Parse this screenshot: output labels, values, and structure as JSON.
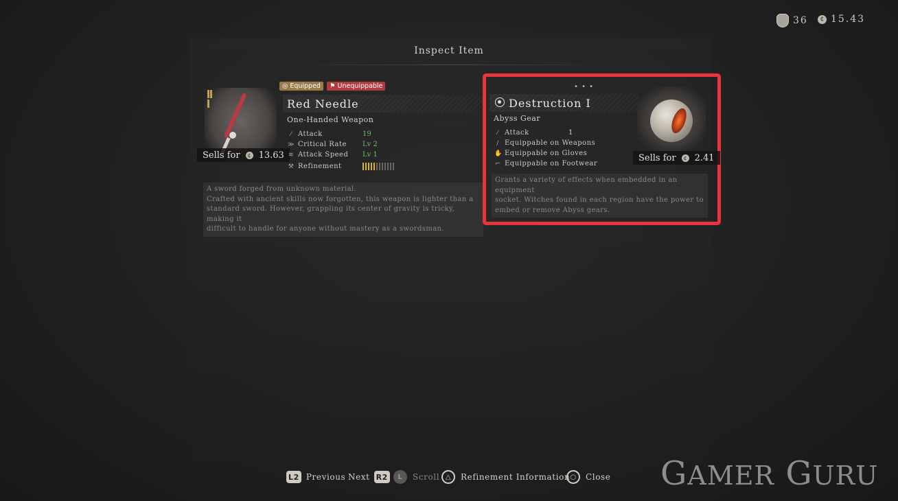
{
  "hud": {
    "tokens": "36",
    "currency": "15.43"
  },
  "title": "Inspect Item",
  "left_item": {
    "badges": {
      "equipped": "Equipped",
      "unequippable": "Unequippable"
    },
    "name": "Red Needle",
    "type": "One-Handed Weapon",
    "stats": [
      {
        "icon": "sword-icon",
        "label": "Attack",
        "value": "19"
      },
      {
        "icon": "critical-icon",
        "label": "Critical Rate",
        "value": "Lv 2"
      },
      {
        "icon": "speed-icon",
        "label": "Attack Speed",
        "value": "Lv 1"
      },
      {
        "icon": "hammer-icon",
        "label": "Refinement",
        "value": ""
      }
    ],
    "refinement_level": 0.4,
    "sells_label": "Sells for",
    "sells_value": "13.63",
    "description": "A sword forged from unknown material.\nCrafted with ancient skills now forgotten, this weapon is lighter than a\nstandard sword. However, grappling its center of gravity is tricky, making it\ndifficult to handle for anyone without mastery as a swordsman."
  },
  "right_item": {
    "page_indicator": "• • •",
    "name": "Destruction Ⅰ",
    "type": "Abyss Gear",
    "stats": [
      {
        "icon": "sword-icon",
        "label": "Attack",
        "value": "1"
      },
      {
        "icon": "weapon-icon",
        "label": "Equippable on Weapons"
      },
      {
        "icon": "glove-icon",
        "label": "Equippable on Gloves"
      },
      {
        "icon": "boot-icon",
        "label": "Equippable on Footwear"
      }
    ],
    "sells_label": "Sells for",
    "sells_value": "2.41",
    "description": "Grants a variety of effects when embedded in an equipment\nsocket. Witches found in each region have the power to\nembed or remove Abyss gears."
  },
  "controls": {
    "l2": "L2",
    "previous": "Previous",
    "next": "Next",
    "r2": "R2",
    "l": "L",
    "scroll": "Scroll",
    "triangle_label": "Refinement Information",
    "close": "Close"
  },
  "watermark": {
    "big1": "G",
    "small1": "AMER",
    "big2": "G",
    "small2": "URU"
  },
  "colors": {
    "highlight": "#e8343c",
    "stat_value": "#6fbf6a",
    "equipped_badge": "#9a7a47",
    "unequippable_badge": "#b13a3a"
  }
}
